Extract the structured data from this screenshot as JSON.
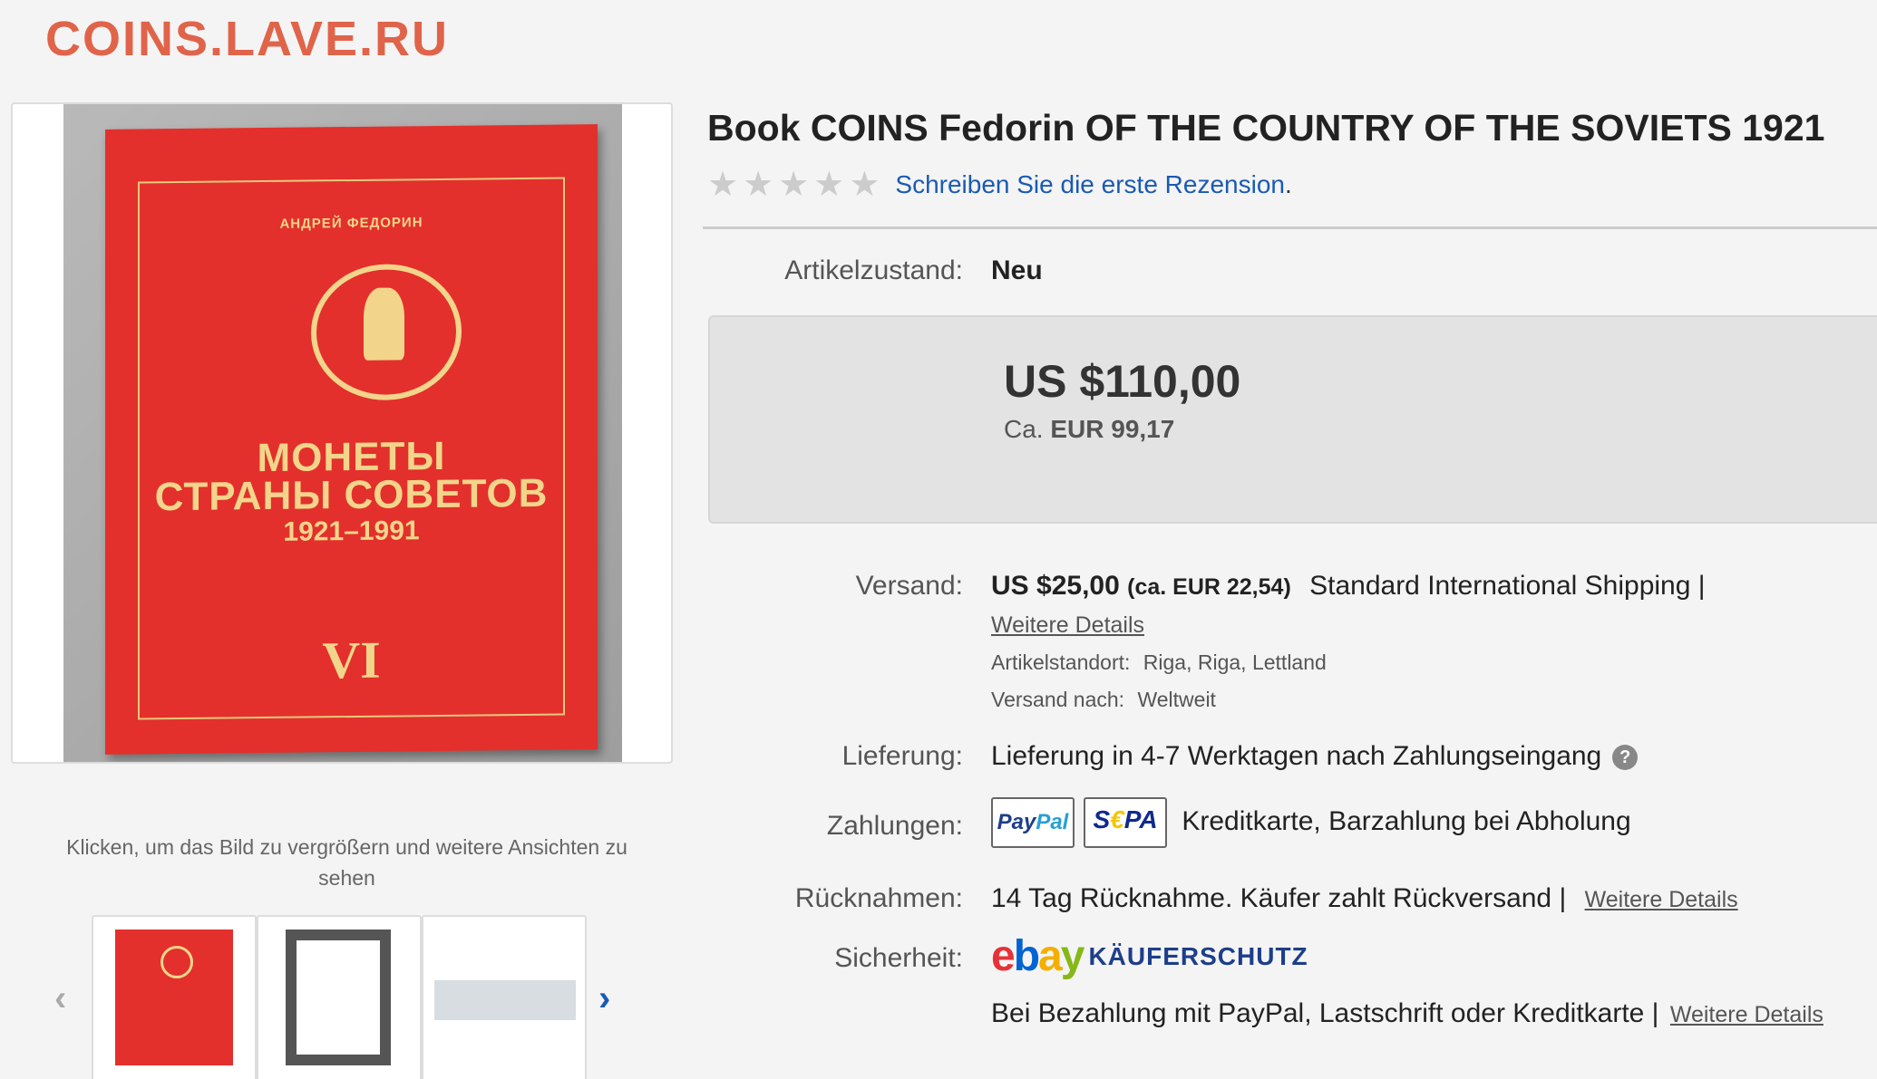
{
  "site": {
    "logo": "COINS.LAVE.RU"
  },
  "gallery": {
    "book": {
      "author": "АНДРЕЙ ФЕДОРИН",
      "title_line1": "МОНЕТЫ",
      "title_line2": "СТРАНЫ СОВЕТОВ",
      "years": "1921–1991",
      "volume": "VI"
    },
    "caption": "Klicken, um das Bild zu vergrößern und weitere Ansichten zu sehen",
    "prev_icon": "‹",
    "next_icon": "›"
  },
  "item": {
    "title": "Book COINS Fedorin OF THE COUNTRY OF THE SOVIETS 1921",
    "rating": {
      "stars": 0,
      "max": 5,
      "review_link": "Schreiben Sie die erste Rezension",
      "review_suffix": "."
    },
    "condition": {
      "label": "Artikelzustand:",
      "value": "Neu"
    },
    "price": {
      "main": "US $110,00",
      "approx_prefix": "Ca.",
      "approx_value": "EUR 99,17"
    },
    "shipping": {
      "label": "Versand:",
      "cost": "US $25,00",
      "cost_approx": "(ca. EUR 22,54)",
      "method": "Standard International Shipping |",
      "details_link": "Weitere Details",
      "location_label": "Artikelstandort:",
      "location_value": "Riga, Riga, Lettland",
      "ships_to_label": "Versand nach:",
      "ships_to_value": "Weltweit"
    },
    "delivery": {
      "label": "Lieferung:",
      "value": "Lieferung in 4-7 Werktagen nach Zahlungseingang",
      "help_icon": "?"
    },
    "payments": {
      "label": "Zahlungen:",
      "paypal_a": "Pay",
      "paypal_b": "Pal",
      "sepa_a": "S",
      "sepa_b": "€",
      "sepa_c": "PA",
      "value": "Kreditkarte, Barzahlung bei Abholung"
    },
    "returns": {
      "label": "Rücknahmen:",
      "value": "14 Tag Rücknahme. Käufer zahlt Rückversand |",
      "details_link": "Weitere Details"
    },
    "security": {
      "label": "Sicherheit:",
      "ebay_e": "e",
      "ebay_b": "b",
      "ebay_a": "a",
      "ebay_y": "y",
      "protection": "KÄUFERSCHUTZ",
      "note": "Bei Bezahlung mit PayPal, Lastschrift oder Kreditkarte |",
      "details_link": "Weitere Details"
    }
  }
}
